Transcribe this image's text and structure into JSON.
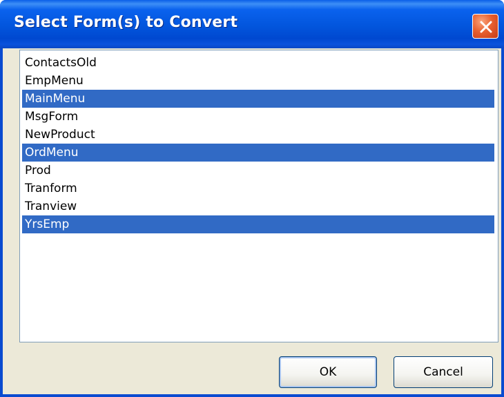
{
  "window": {
    "title": "Select Form(s) to Convert"
  },
  "list": {
    "items": [
      {
        "label": "ContactsOld",
        "selected": false
      },
      {
        "label": "EmpMenu",
        "selected": false
      },
      {
        "label": "MainMenu",
        "selected": true
      },
      {
        "label": "MsgForm",
        "selected": false
      },
      {
        "label": "NewProduct",
        "selected": false
      },
      {
        "label": "OrdMenu",
        "selected": true
      },
      {
        "label": "Prod",
        "selected": false
      },
      {
        "label": "Tranform",
        "selected": false
      },
      {
        "label": "Tranview",
        "selected": false
      },
      {
        "label": "YrsEmp",
        "selected": true
      }
    ]
  },
  "buttons": {
    "ok_label": "OK",
    "cancel_label": "Cancel"
  },
  "colors": {
    "titlebar": "#0255dc",
    "selection": "#316ac5",
    "dialog_bg": "#ece9d8",
    "close_button": "#e8602f"
  },
  "icons": {
    "close": "close-icon"
  }
}
